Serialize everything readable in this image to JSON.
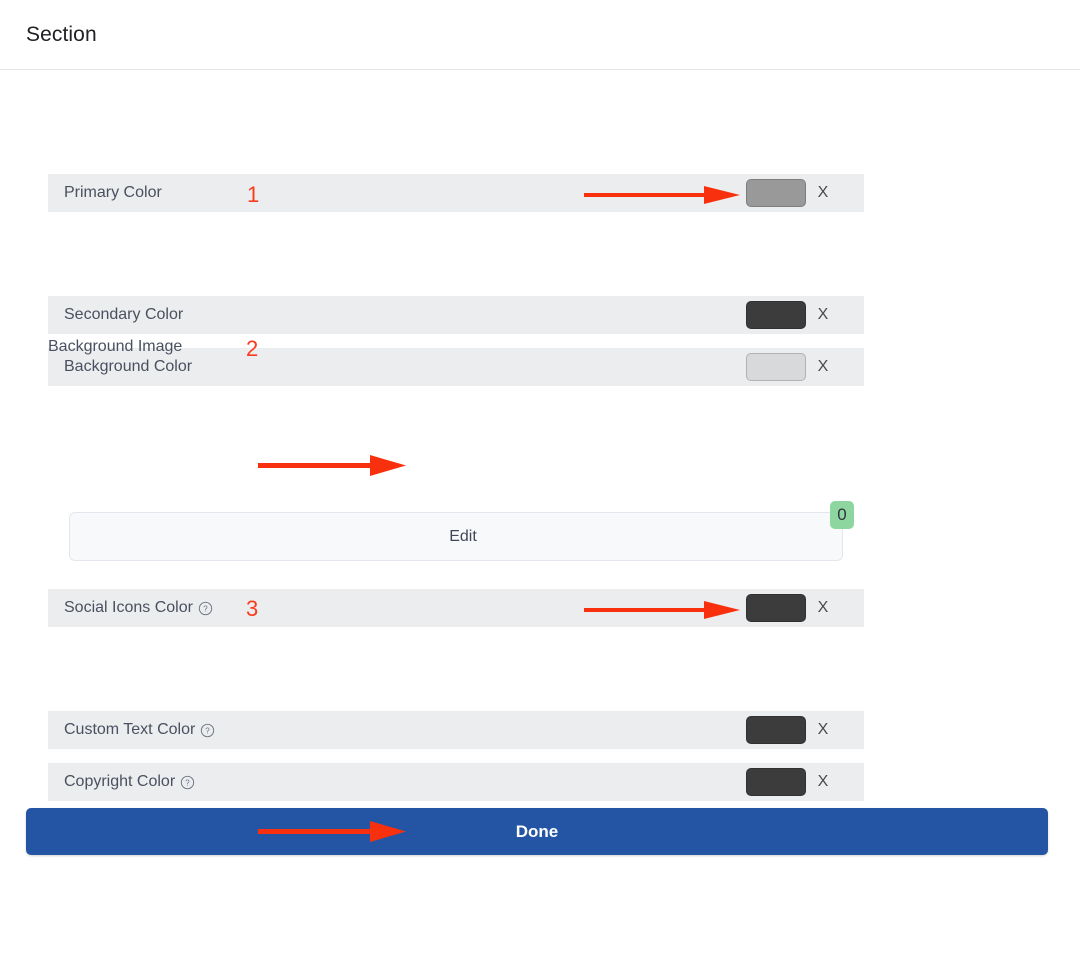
{
  "header": {
    "title": "Section"
  },
  "colors": {
    "accent_blue": "#2455a4",
    "row_background": "#ebedef",
    "label_text": "#4a505f",
    "annotation_red": "#fc3a1c",
    "badge_green": "#8ed6a0",
    "panel_background": "#f8f9fb"
  },
  "settings": {
    "top_rows": [
      {
        "label": "Primary Color",
        "swatch": "#999999",
        "clear_label": "X",
        "help": false
      },
      {
        "label": "Secondary Color",
        "swatch": "#3c3c3c",
        "clear_label": "X",
        "help": false
      },
      {
        "label": "Background Color",
        "swatch": "#d8d9da",
        "clear_label": "X",
        "help": false
      }
    ],
    "background_image": {
      "label": "Background Image"
    },
    "edit_panel": {
      "edit_label": "Edit",
      "badge_count": "0"
    },
    "bottom_rows": [
      {
        "label": "Social Icons Color",
        "swatch": "#3c3c3c",
        "clear_label": "X",
        "help": true
      },
      {
        "label": "Custom Text Color",
        "swatch": "#3c3c3c",
        "clear_label": "X",
        "help": true
      },
      {
        "label": "Copyright Color",
        "swatch": "#3c3c3c",
        "clear_label": "X",
        "help": true
      }
    ]
  },
  "footer": {
    "done_label": "Done"
  },
  "annotations": {
    "numbers": [
      {
        "text": "1"
      },
      {
        "text": "2"
      },
      {
        "text": "3"
      }
    ]
  }
}
